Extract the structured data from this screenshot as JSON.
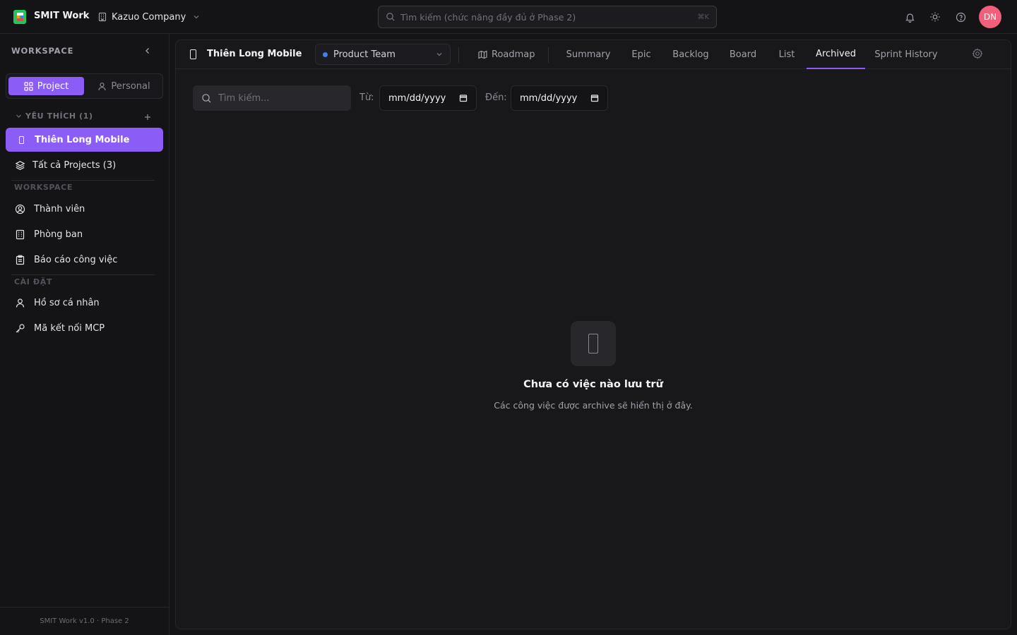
{
  "app": {
    "name": "SMIT Work",
    "company": "Kazuo Company"
  },
  "search": {
    "placeholder": "Tìm kiếm (chức năng đầy đủ ở Phase 2)",
    "shortcut": "⌘K"
  },
  "user": {
    "initials": "DN",
    "avatar_color": "#f0607a"
  },
  "colors": {
    "accent": "#8b5cf6",
    "team_dot": "#3b82f6"
  },
  "sidebar": {
    "title": "WORKSPACE",
    "toggle": {
      "project": "Project",
      "personal": "Personal"
    },
    "favorites_label": "YÊU THÍCH (1)",
    "favorites": [
      {
        "label": "Thiên Long Mobile",
        "icon": "mobile-icon"
      }
    ],
    "all_projects": "Tất cả Projects (3)",
    "workspace_label": "WORKSPACE",
    "workspace_items": [
      {
        "label": "Thành viên",
        "icon": "user-circle-icon"
      },
      {
        "label": "Phòng ban",
        "icon": "building-icon"
      },
      {
        "label": "Báo cáo công việc",
        "icon": "clipboard-icon"
      }
    ],
    "settings_label": "CÀI ĐẶT",
    "settings_items": [
      {
        "label": "Hồ sơ cá nhân",
        "icon": "user-icon"
      },
      {
        "label": "Mã kết nối MCP",
        "icon": "key-icon"
      }
    ],
    "footer": "SMIT Work v1.0 · Phase 2"
  },
  "project": {
    "name": "Thiên Long Mobile",
    "team": "Product Team",
    "tabs": [
      "Roadmap",
      "Summary",
      "Epic",
      "Backlog",
      "Board",
      "List",
      "Archived",
      "Sprint History"
    ],
    "active_tab": "Archived"
  },
  "filters": {
    "search_placeholder": "Tìm kiếm...",
    "from_label": "Từ:",
    "to_label": "Đến:",
    "from_value": "mm/dd/yyyy",
    "to_value": "mm/dd/yyyy"
  },
  "empty_state": {
    "title": "Chưa có việc nào lưu trữ",
    "subtitle": "Các công việc được archive sẽ hiển thị ở đây."
  }
}
